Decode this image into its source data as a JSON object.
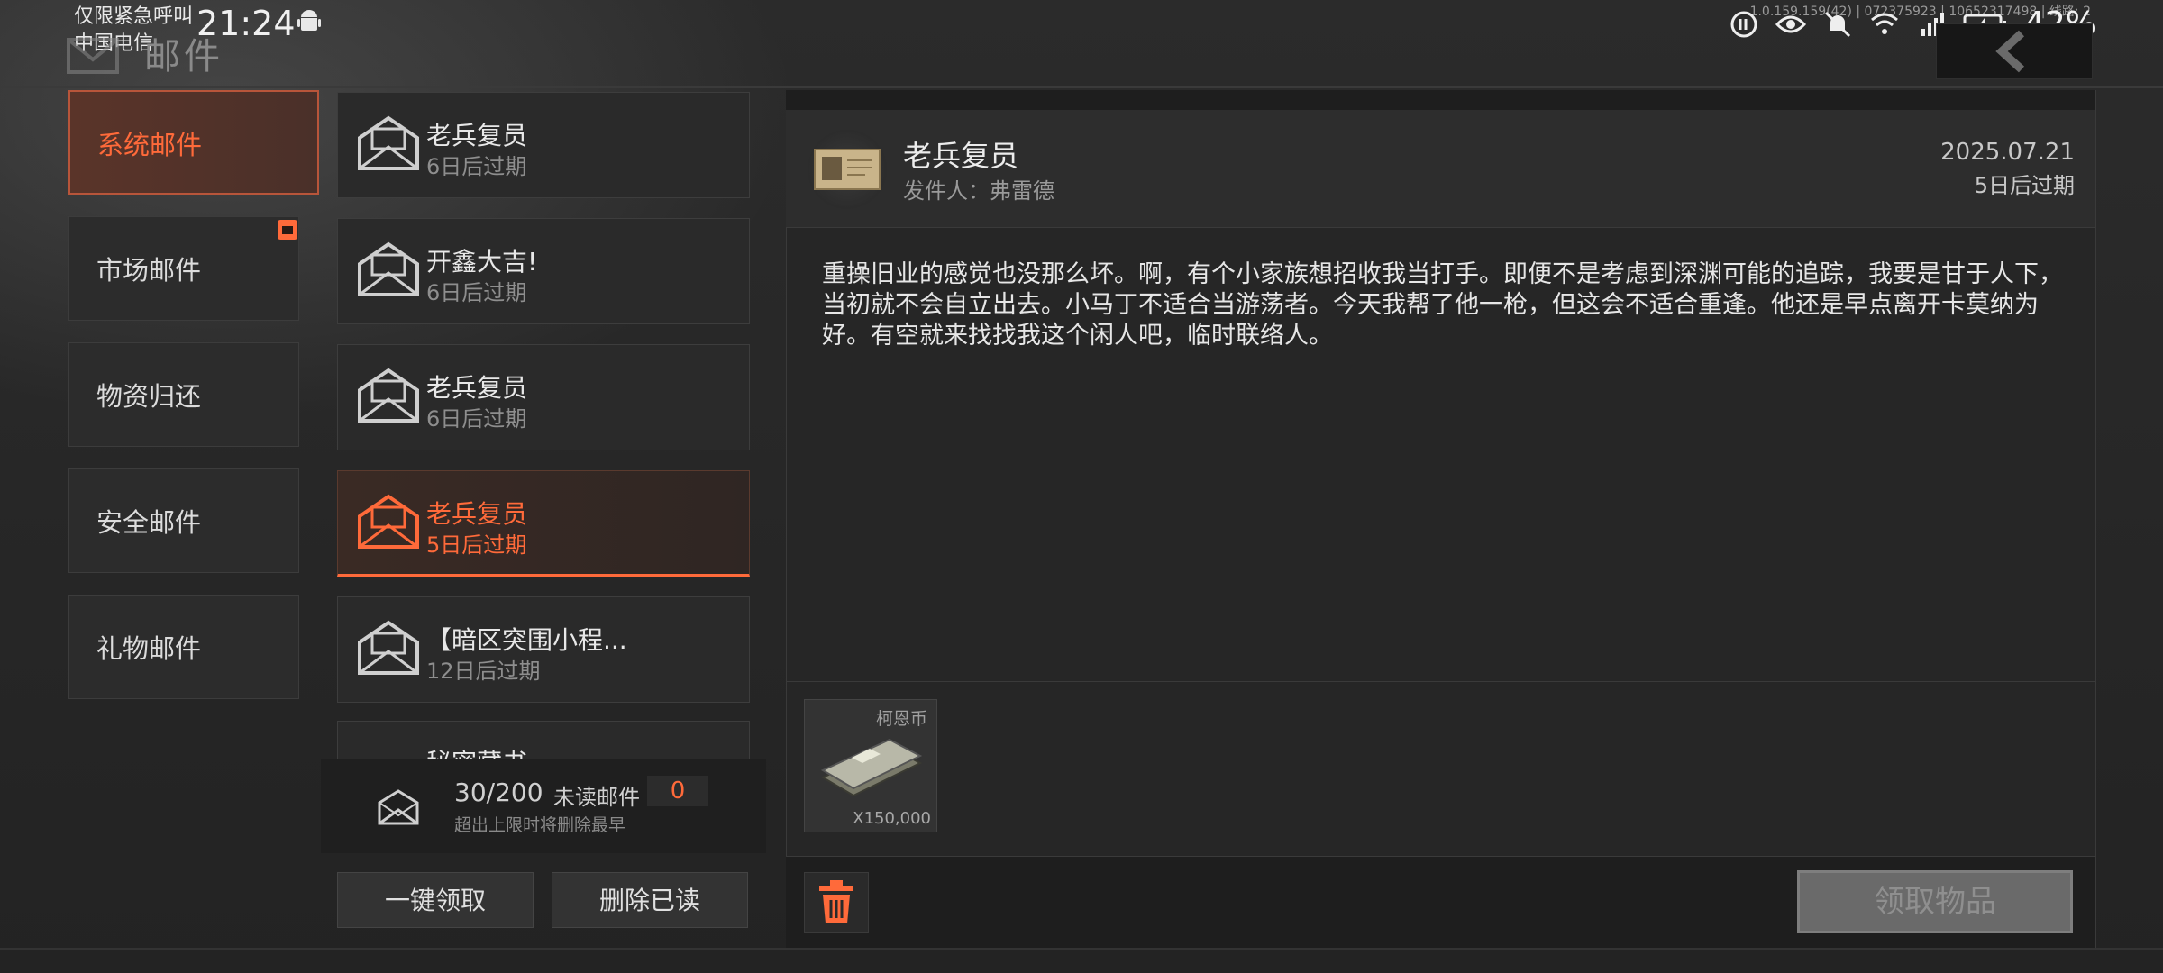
{
  "status_bar": {
    "emergency": "仅限紧急呼叫",
    "carrier": "中国电信",
    "time": "21:24",
    "battery": "42%",
    "version": "1.0.159.159(42) | 072375923 | 10652317498 | 线路: 2"
  },
  "header": {
    "title": "邮件"
  },
  "categories": [
    {
      "label": "系统邮件"
    },
    {
      "label": "市场邮件"
    },
    {
      "label": "物资归还"
    },
    {
      "label": "安全邮件"
    },
    {
      "label": "礼物邮件"
    }
  ],
  "mails": [
    {
      "title": "老兵复员",
      "expiry": "6日后过期"
    },
    {
      "title": "开鑫大吉!",
      "expiry": "6日后过期"
    },
    {
      "title": "老兵复员",
      "expiry": "6日后过期"
    },
    {
      "title": "老兵复员",
      "expiry": "5日后过期"
    },
    {
      "title": "【暗区突围小程...",
      "expiry": "12日后过期"
    },
    {
      "title": "秘密藏书",
      "expiry": ""
    }
  ],
  "summary": {
    "count": "30/200",
    "unread_label": "未读邮件",
    "unread_count": "0",
    "hint": "超出上限时将删除最早"
  },
  "actions": {
    "claim_all": "一键领取",
    "delete_read": "删除已读"
  },
  "detail": {
    "title": "老兵复员",
    "sender_label": "发件人：",
    "sender_name": "弗雷德",
    "date": "2025.07.21",
    "expiry": "5日后过期",
    "body": "重操旧业的感觉也没那么坏。啊，有个小家族想招收我当打手。即便不是考虑到深渊可能的追踪，我要是甘于人下，当初就不会自立出去。小马丁不适合当游荡者。今天我帮了他一枪，但这会不适合重逢。他还是早点离开卡莫纳为好。有空就来找找我这个闲人吧，临时联络人。",
    "attachment_name": "柯恩币",
    "attachment_qty": "X150,000",
    "claim_button": "领取物品"
  },
  "colors": {
    "accent": "#ff6a3a",
    "panel": "#262626",
    "background": "#242424"
  }
}
